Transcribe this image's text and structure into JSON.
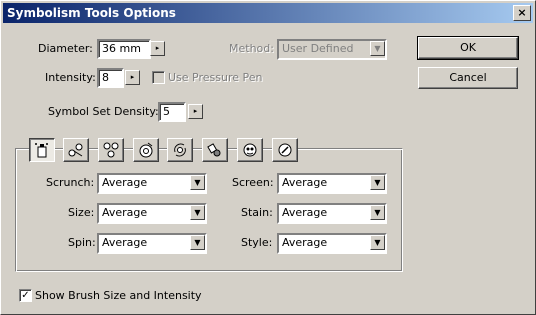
{
  "window": {
    "title": "Symbolism Tools Options"
  },
  "titlebar": {
    "close_label": "×"
  },
  "diameter": {
    "label": "Diameter:",
    "value": "36 mm"
  },
  "method": {
    "label": "Method:",
    "value": "User Defined"
  },
  "intensity": {
    "label": "Intensity:",
    "value": "8"
  },
  "pressure_pen": {
    "label": "Use Pressure Pen",
    "checked": false
  },
  "density": {
    "label": "Symbol Set Density:",
    "value": "5"
  },
  "buttons": {
    "ok": "OK",
    "cancel": "Cancel"
  },
  "tools": [
    {
      "icon": "sprayer-icon"
    },
    {
      "icon": "shifter-icon"
    },
    {
      "icon": "scruncher-icon"
    },
    {
      "icon": "sizer-icon"
    },
    {
      "icon": "spinner-icon"
    },
    {
      "icon": "stainer-icon"
    },
    {
      "icon": "screener-icon"
    },
    {
      "icon": "styler-icon"
    }
  ],
  "options": {
    "scrunch": {
      "label": "Scrunch:",
      "value": "Average"
    },
    "size": {
      "label": "Size:",
      "value": "Average"
    },
    "spin": {
      "label": "Spin:",
      "value": "Average"
    },
    "screen": {
      "label": "Screen:",
      "value": "Average"
    },
    "stain": {
      "label": "Stain:",
      "value": "Average"
    },
    "style": {
      "label": "Style:",
      "value": "Average"
    }
  },
  "show_brush": {
    "label": "Show Brush Size and Intensity",
    "checked": true
  },
  "glyphs": {
    "right_arrow": "▸",
    "down_arrow": "▼",
    "check": "✓"
  }
}
